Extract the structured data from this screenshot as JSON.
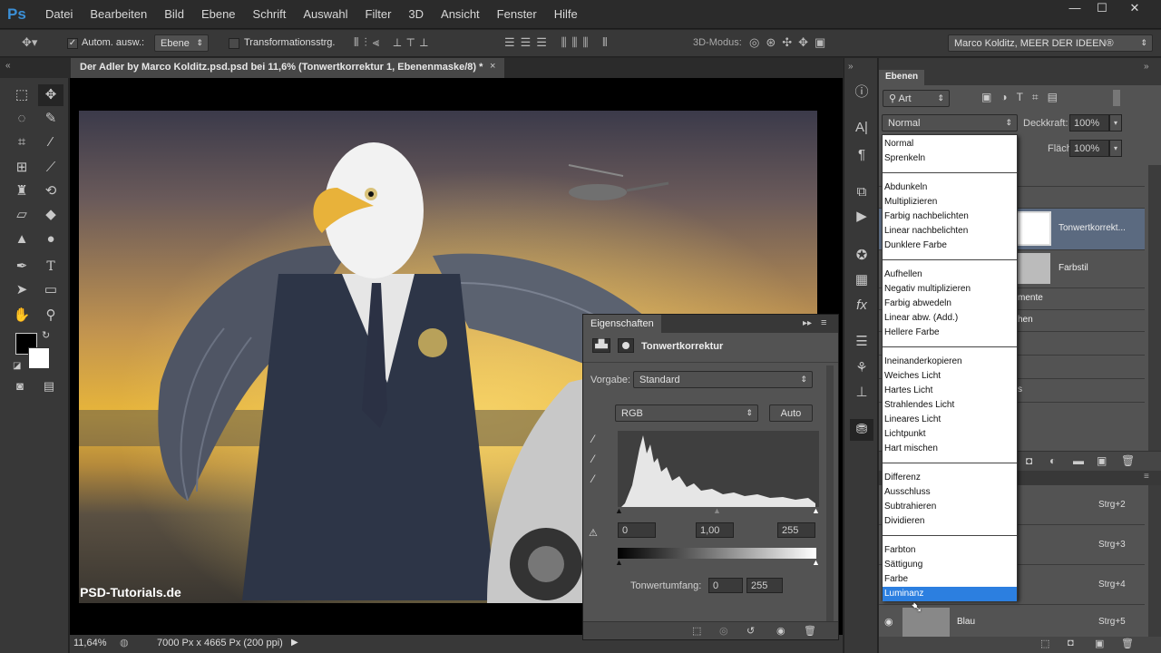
{
  "app": {
    "logo": "Ps"
  },
  "menu": [
    "Datei",
    "Bearbeiten",
    "Bild",
    "Ebene",
    "Schrift",
    "Auswahl",
    "Filter",
    "3D",
    "Ansicht",
    "Fenster",
    "Hilfe"
  ],
  "window_controls": {
    "minimize": "—",
    "maximize": "☐",
    "close": "✕"
  },
  "options": {
    "auto_select_label": "Autom. ausw.:",
    "auto_select_value": "Ebene",
    "transform_label": "Transformationsstrg.",
    "mode3d_label": "3D-Modus:",
    "workspace": "Marco Kolditz, MEER DER IDEEN®"
  },
  "document": {
    "tab_title": "Der Adler by Marco Kolditz.psd.psd bei 11,6% (Tonwertkorrektur 1, Ebenenmaske/8) *",
    "close": "×",
    "zoom": "11,64%",
    "doc_info": "7000 Px x 4665 Px (200 ppi)",
    "watermark": "PSD-Tutorials.de"
  },
  "properties": {
    "tab": "Eigenschaften",
    "title": "Tonwertkorrektur",
    "preset_label": "Vorgabe:",
    "preset_value": "Standard",
    "channel": "RGB",
    "auto_button": "Auto",
    "input_black": "0",
    "input_gamma": "1,00",
    "input_white": "255",
    "output_label": "Tonwertumfang:",
    "output_black": "0",
    "output_white": "255"
  },
  "layers_panel": {
    "tab": "Ebenen",
    "filter_kind": "Art",
    "blend_mode": "Normal",
    "opacity_label": "Deckkraft:",
    "opacity_value": "100%",
    "fill_label": "Fläche:",
    "fill_value": "100%",
    "rows": [
      {
        "name": "Tonwertkorrekt..."
      },
      {
        "name": "Farbstil"
      },
      {
        "name": "mente"
      },
      {
        "name": "hen"
      },
      {
        "name": "s"
      }
    ]
  },
  "channels_panel": {
    "rows": [
      {
        "shortcut": "Strg+2"
      },
      {
        "shortcut": "Strg+3"
      },
      {
        "shortcut": "Strg+4"
      },
      {
        "name": "Blau",
        "shortcut": "Strg+5"
      }
    ]
  },
  "blend_menu": {
    "groups": [
      [
        "Normal",
        "Sprenkeln"
      ],
      [
        "Abdunkeln",
        "Multiplizieren",
        "Farbig nachbelichten",
        "Linear nachbelichten",
        "Dunklere Farbe"
      ],
      [
        "Aufhellen",
        "Negativ multiplizieren",
        "Farbig abwedeln",
        "Linear abw. (Add.)",
        "Hellere Farbe"
      ],
      [
        "Ineinanderkopieren",
        "Weiches Licht",
        "Hartes Licht",
        "Strahlendes Licht",
        "Lineares Licht",
        "Lichtpunkt",
        "Hart mischen"
      ],
      [
        "Differenz",
        "Ausschluss",
        "Subtrahieren",
        "Dividieren"
      ],
      [
        "Farbton",
        "Sättigung",
        "Farbe",
        "Luminanz"
      ]
    ],
    "selected": "Luminanz"
  },
  "colors": {
    "accent": "#3b8fd6",
    "selection": "#2c7fe0"
  }
}
